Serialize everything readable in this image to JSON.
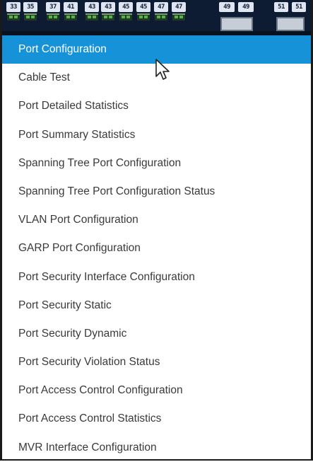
{
  "switch_panel": {
    "port_labels": [
      "33",
      "35",
      "37",
      "41",
      "43",
      "43",
      "45",
      "45",
      "47",
      "47",
      "49",
      "49",
      "51",
      "51"
    ],
    "led_color": "#59b04a",
    "panel_color": "#0d1b33"
  },
  "menu": {
    "active_color": "#1692d9",
    "items": [
      {
        "label": "Port Configuration",
        "active": true
      },
      {
        "label": "Cable Test",
        "active": false
      },
      {
        "label": "Port Detailed Statistics",
        "active": false
      },
      {
        "label": "Port Summary Statistics",
        "active": false
      },
      {
        "label": "Spanning Tree Port Configuration",
        "active": false
      },
      {
        "label": "Spanning Tree Port Configuration Status",
        "active": false
      },
      {
        "label": "VLAN Port Configuration",
        "active": false
      },
      {
        "label": "GARP Port Configuration",
        "active": false
      },
      {
        "label": "Port Security Interface Configuration",
        "active": false
      },
      {
        "label": "Port Security Static",
        "active": false
      },
      {
        "label": "Port Security Dynamic",
        "active": false
      },
      {
        "label": "Port Security Violation Status",
        "active": false
      },
      {
        "label": "Port Access Control Configuration",
        "active": false
      },
      {
        "label": "Port Access Control Statistics",
        "active": false
      },
      {
        "label": "MVR Interface Configuration",
        "active": false
      }
    ]
  },
  "cursor": {
    "icon": "mouse-pointer-icon"
  }
}
